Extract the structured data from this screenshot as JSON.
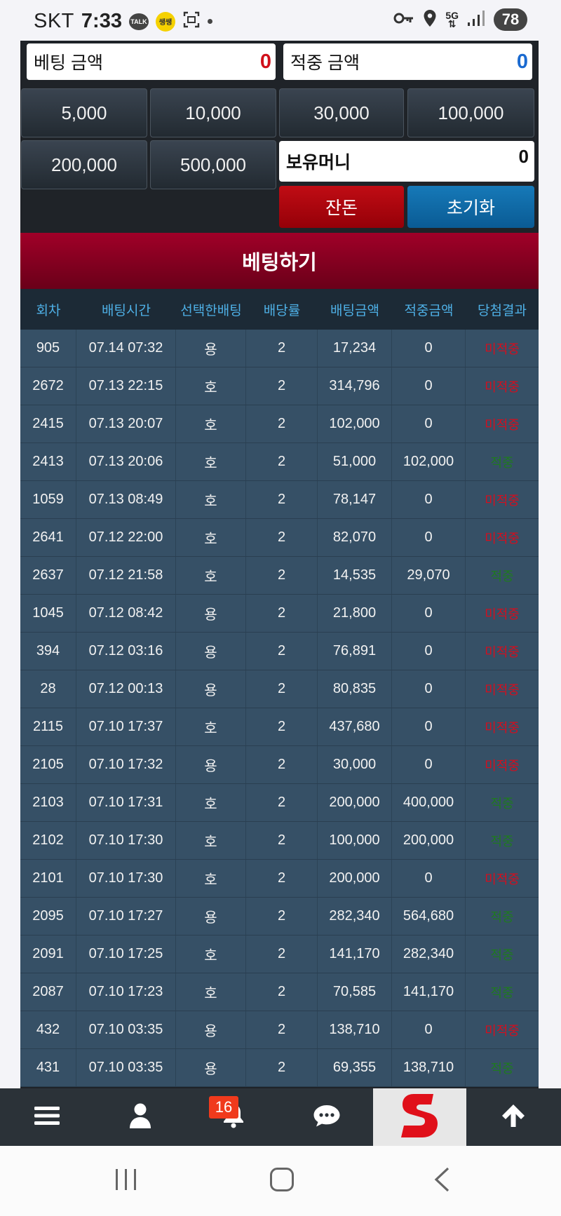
{
  "status_bar": {
    "carrier": "SKT",
    "time": "7:33",
    "talk_label": "TALK",
    "notif_label": "쌩쌩",
    "network": "5G",
    "battery": "78"
  },
  "bet_panel": {
    "bet_amount_label": "베팅 금액",
    "bet_amount_value": "0",
    "win_amount_label": "적중 금액",
    "win_amount_value": "0",
    "chips": [
      "5,000",
      "10,000",
      "30,000",
      "100,000",
      "200,000",
      "500,000"
    ],
    "wallet_label": "보유머니",
    "wallet_value": "0",
    "change_label": "잔돈",
    "reset_label": "초기화",
    "bet_button_label": "베팅하기"
  },
  "history": {
    "columns": [
      "회차",
      "배팅시간",
      "선택한배팅",
      "배당률",
      "배팅금액",
      "적중금액",
      "당첨결과"
    ],
    "rows": [
      [
        "905",
        "07.14 07:32",
        "용",
        "2",
        "17,234",
        "0",
        "미적중"
      ],
      [
        "2672",
        "07.13 22:15",
        "호",
        "2",
        "314,796",
        "0",
        "미적중"
      ],
      [
        "2415",
        "07.13 20:07",
        "호",
        "2",
        "102,000",
        "0",
        "미적중"
      ],
      [
        "2413",
        "07.13 20:06",
        "호",
        "2",
        "51,000",
        "102,000",
        "적중"
      ],
      [
        "1059",
        "07.13 08:49",
        "호",
        "2",
        "78,147",
        "0",
        "미적중"
      ],
      [
        "2641",
        "07.12 22:00",
        "호",
        "2",
        "82,070",
        "0",
        "미적중"
      ],
      [
        "2637",
        "07.12 21:58",
        "호",
        "2",
        "14,535",
        "29,070",
        "적중"
      ],
      [
        "1045",
        "07.12 08:42",
        "용",
        "2",
        "21,800",
        "0",
        "미적중"
      ],
      [
        "394",
        "07.12 03:16",
        "용",
        "2",
        "76,891",
        "0",
        "미적중"
      ],
      [
        "28",
        "07.12 00:13",
        "용",
        "2",
        "80,835",
        "0",
        "미적중"
      ],
      [
        "2115",
        "07.10 17:37",
        "호",
        "2",
        "437,680",
        "0",
        "미적중"
      ],
      [
        "2105",
        "07.10 17:32",
        "용",
        "2",
        "30,000",
        "0",
        "미적중"
      ],
      [
        "2103",
        "07.10 17:31",
        "호",
        "2",
        "200,000",
        "400,000",
        "적중"
      ],
      [
        "2102",
        "07.10 17:30",
        "호",
        "2",
        "100,000",
        "200,000",
        "적중"
      ],
      [
        "2101",
        "07.10 17:30",
        "호",
        "2",
        "200,000",
        "0",
        "미적중"
      ],
      [
        "2095",
        "07.10 17:27",
        "용",
        "2",
        "282,340",
        "564,680",
        "적중"
      ],
      [
        "2091",
        "07.10 17:25",
        "호",
        "2",
        "141,170",
        "282,340",
        "적중"
      ],
      [
        "2087",
        "07.10 17:23",
        "호",
        "2",
        "70,585",
        "141,170",
        "적중"
      ],
      [
        "432",
        "07.10 03:35",
        "용",
        "2",
        "138,710",
        "0",
        "미적중"
      ],
      [
        "431",
        "07.10 03:35",
        "용",
        "2",
        "69,355",
        "138,710",
        "적중"
      ]
    ]
  },
  "bottom_nav": {
    "items": [
      "menu-icon",
      "user-icon",
      "bell-icon",
      "chat-icon",
      "logo",
      "arrow-up-icon"
    ],
    "notification_count": "16"
  },
  "colors": {
    "lose": "#d40e1e",
    "win": "#1f7a1f",
    "header_text": "#4eb0e6",
    "bet_button": "#8a0022",
    "change_button": "#b3000c",
    "reset_button": "#0f6aa6"
  }
}
